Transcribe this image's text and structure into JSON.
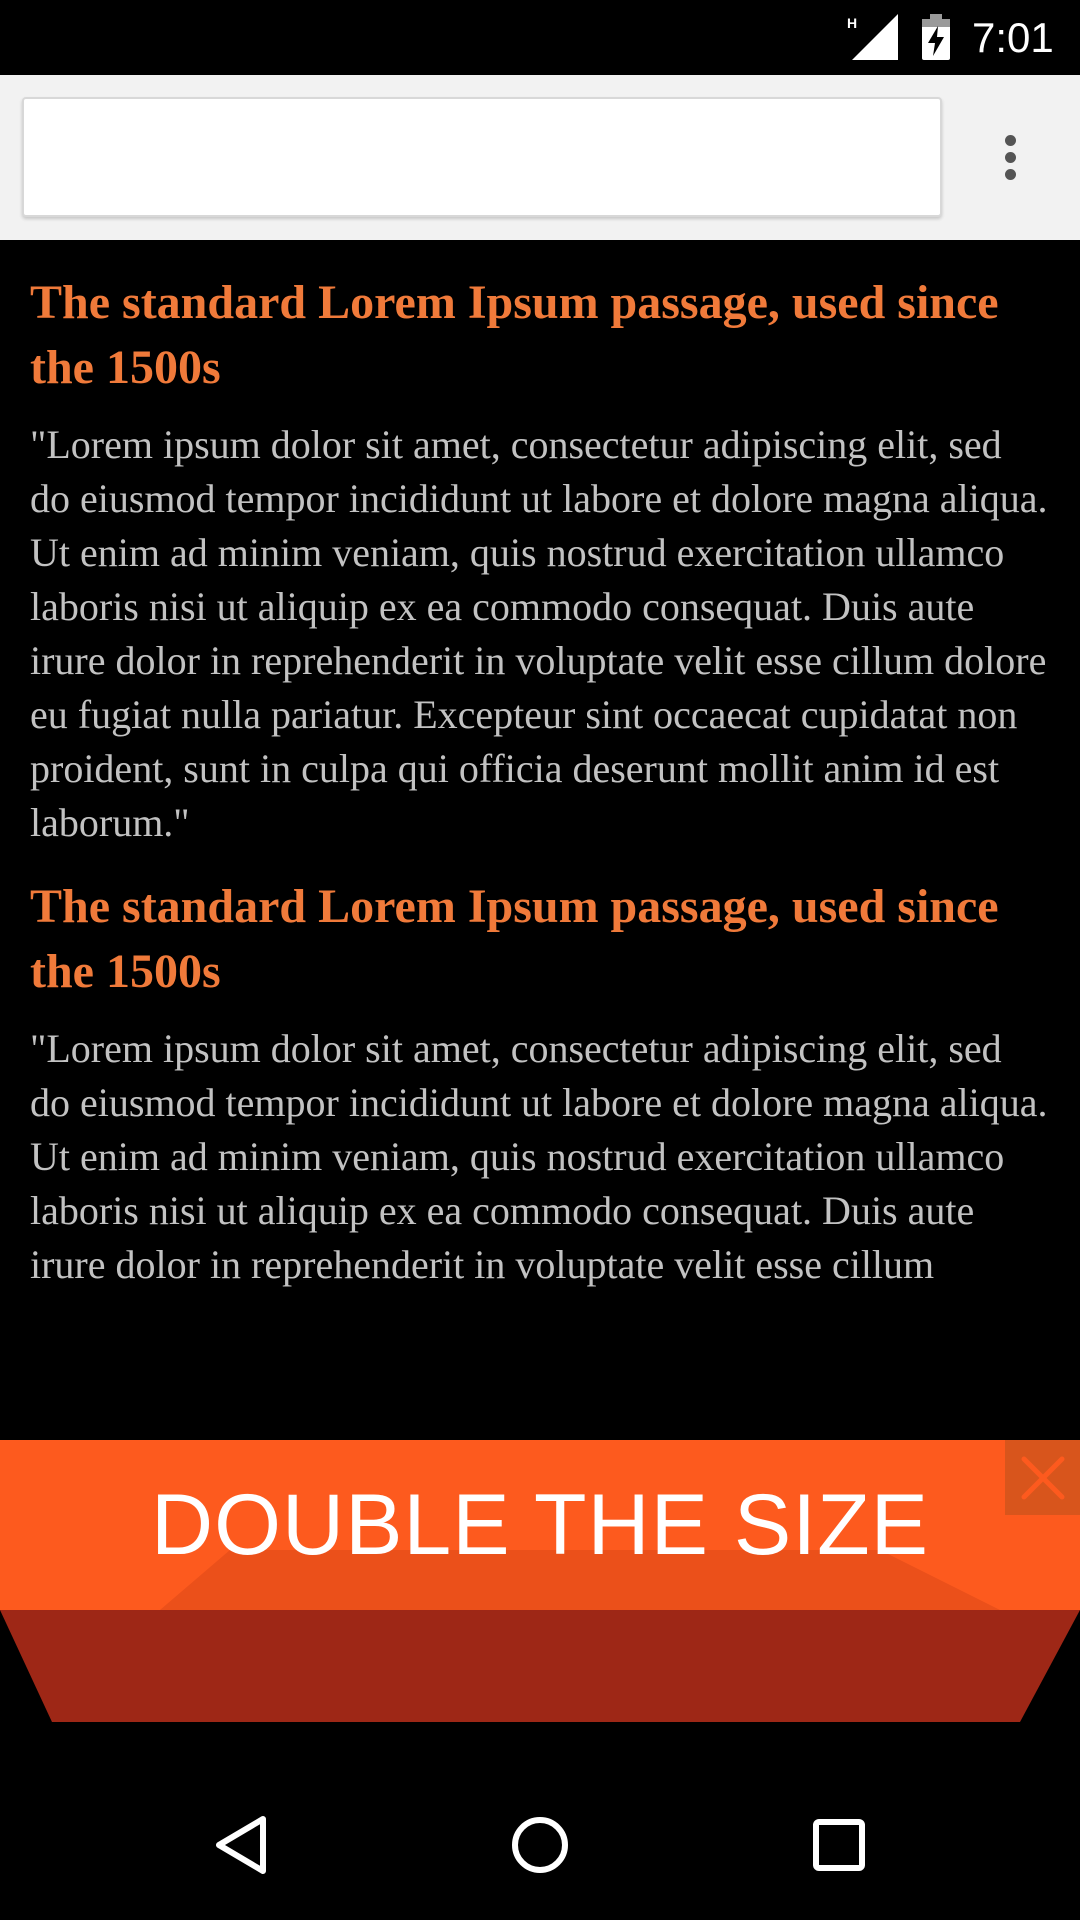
{
  "status_bar": {
    "time": "7:01",
    "network_label": "H",
    "icons": [
      "signal-icon",
      "battery-charging-icon"
    ]
  },
  "browser": {
    "url_value": "",
    "url_placeholder": "",
    "menu_icon": "overflow-menu-icon"
  },
  "articles": [
    {
      "heading": "The standard Lorem Ipsum passage, used since the 1500s",
      "body": "\"Lorem ipsum dolor sit amet, consectetur adipiscing elit, sed do eiusmod tempor incididunt ut labore et dolore magna aliqua. Ut enim ad minim veniam, quis nostrud exercitation ullamco laboris nisi ut aliquip ex ea commodo consequat. Duis aute irure dolor in reprehenderit in voluptate velit esse cillum dolore eu fugiat nulla pariatur. Excepteur sint occaecat cupidatat non proident, sunt in culpa qui officia deserunt mollit anim id est laborum.\""
    },
    {
      "heading": "The standard Lorem Ipsum passage, used since the 1500s",
      "body": "\"Lorem ipsum dolor sit amet, consectetur adipiscing elit, sed do eiusmod tempor incididunt ut labore et dolore magna aliqua. Ut enim ad minim veniam, quis nostrud exercitation ullamco laboris nisi ut aliquip ex ea commodo consequat. Duis aute irure dolor in reprehenderit in voluptate velit esse cillum"
    }
  ],
  "promo": {
    "label": "DOUBLE THE SIZE",
    "close_icon": "close-icon"
  },
  "nav_bar": {
    "icons": [
      "back-icon",
      "home-icon",
      "recents-icon"
    ]
  },
  "colors": {
    "heading": "#f07a3a",
    "body_text": "#c2c2c2",
    "banner_orange": "#fd5a1e",
    "banner_dark": "#9e2716"
  }
}
